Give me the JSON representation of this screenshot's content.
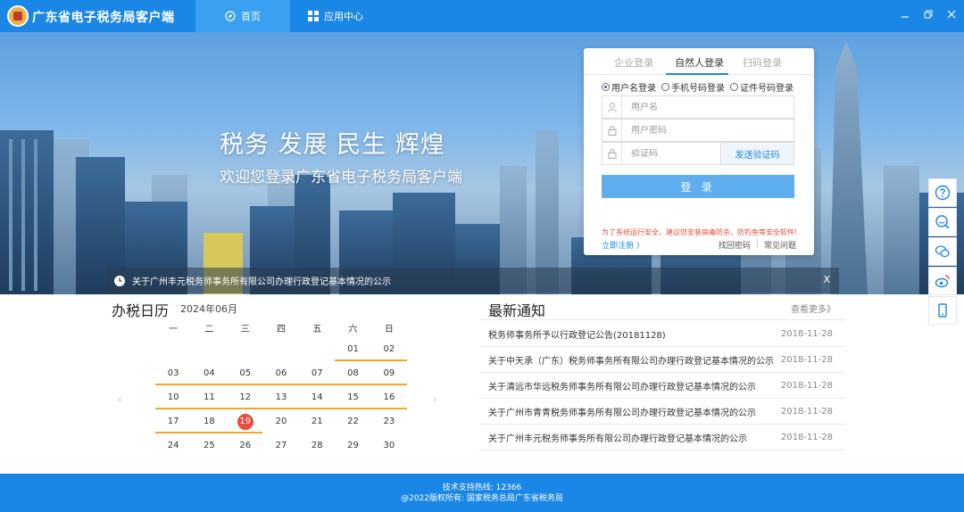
{
  "header": {
    "app_title": "广东省电子税务局客户端",
    "nav": {
      "home": "首页",
      "apps": "应用中心"
    },
    "icons": [
      "emblem-icon",
      "compass-icon",
      "grid-icon",
      "minimize-icon",
      "restore-icon",
      "close-icon"
    ]
  },
  "hero": {
    "title": "税务 发展   民生 辉煌",
    "subtitle": "欢迎您登录广东省电子税务局客户端",
    "ticker_text": "关于广州丰元税务师事务所有限公司办理行政登记基本情况的公示",
    "ticker_close": "X"
  },
  "login": {
    "tabs": {
      "enterprise": "企业登录",
      "person": "自然人登录",
      "qr": "扫码登录"
    },
    "modes": {
      "username": "用户名登录",
      "phone": "手机号码登录",
      "idcard": "证件号码登录"
    },
    "username_placeholder": "用户名",
    "password_placeholder": "用户密码",
    "code_placeholder": "验证码",
    "send_code": "发送验证码",
    "submit": "登 录",
    "warning": "为了系统运行安全，建议您安装病毒防杀、防钓鱼等安全软件!",
    "register": "立即注册 〉",
    "forgot": "找回密码",
    "separator": "|",
    "faq": "常见问题"
  },
  "calendar": {
    "title": "办税日历",
    "month": "2024年06月",
    "weekdays": [
      "一",
      "二",
      "三",
      "四",
      "五",
      "六",
      "日"
    ],
    "today": "19",
    "weeks": [
      [
        "",
        "",
        "",
        "",
        "",
        "01",
        "02"
      ],
      [
        "03",
        "04",
        "05",
        "06",
        "07",
        "08",
        "09"
      ],
      [
        "10",
        "11",
        "12",
        "13",
        "14",
        "15",
        "16"
      ],
      [
        "17",
        "18",
        "19",
        "20",
        "21",
        "22",
        "23"
      ],
      [
        "24",
        "25",
        "26",
        "27",
        "28",
        "29",
        "30"
      ]
    ],
    "prev": "‹",
    "next": "›"
  },
  "news": {
    "title": "最新通知",
    "more": "查看更多》",
    "items": [
      {
        "text": "税务师事务所予以行政登记公告(20181128)",
        "date": "2018-11-28"
      },
      {
        "text": "关于中天承（广东）税务师事务所有限公司办理行政登记基本情况的公示",
        "date": "2018-11-28"
      },
      {
        "text": "关于清远市华远税务师事务所有限公司办理行政登记基本情况的公示",
        "date": "2018-11-28"
      },
      {
        "text": "关于广州市青青税务师事务所有限公司办理行政登记基本情况的公示",
        "date": "2018-11-28"
      },
      {
        "text": "关于广州丰元税务师事务所有限公司办理行政登记基本情况的公示",
        "date": "2018-11-28"
      }
    ]
  },
  "sidebar_tools": [
    "help-icon",
    "search-icon",
    "wechat-icon",
    "weibo-icon",
    "mobile-icon"
  ],
  "footer": {
    "hotline": "技术支持热线:   12366",
    "copyright": "@2022版权所有:   国家税务总局广东省税务局"
  },
  "colors": {
    "primary": "#1a87e6",
    "button": "#5eaef0",
    "today": "#e74c3c",
    "underline": "#f5a623"
  }
}
